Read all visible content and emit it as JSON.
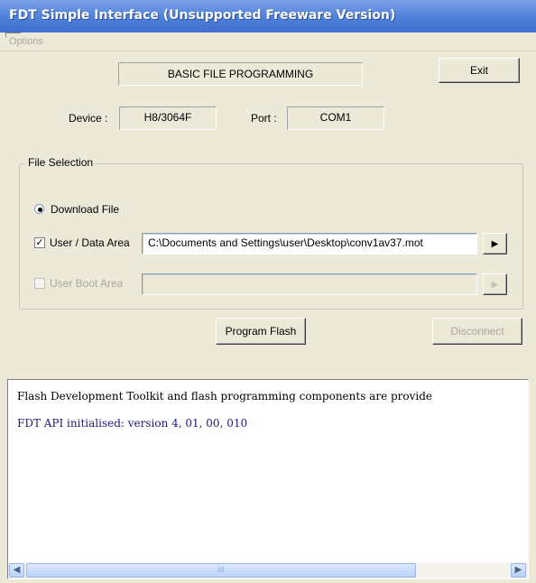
{
  "window": {
    "title": "FDT Simple Interface   (Unsupported Freeware Version)"
  },
  "menu": {
    "options_label": "Options"
  },
  "header": {
    "mode_label": "BASIC FILE PROGRAMMING",
    "exit_label": "Exit"
  },
  "device": {
    "label": "Device :",
    "value": "H8/3064F"
  },
  "port": {
    "label": "Port :",
    "value": "COM1"
  },
  "file_selection": {
    "title": "File Selection",
    "download_label": "Download File",
    "download_selected": true,
    "user_data_label": "User / Data Area",
    "user_data_checked": true,
    "user_data_path": "C:\\Documents and Settings\\user\\Desktop\\conv1av37.mot",
    "browse_icon": "play-arrow-icon",
    "user_boot_label": "User Boot Area",
    "user_boot_checked": false,
    "user_boot_path": ""
  },
  "actions": {
    "program_flash_label": "Program Flash",
    "disconnect_label": "Disconnect"
  },
  "log": {
    "lines": [
      "Flash Development Toolkit and flash programming components are provide",
      "FDT API initialised: version 4, 01, 00, 010"
    ],
    "line_colors": [
      "#000000",
      "#1a1a80"
    ],
    "scroll_thumb_grip": "III"
  },
  "colors": {
    "titlebar": "#4e7fd9",
    "window_bg": "#ece9d8",
    "log_info_text": "#1a1a80"
  }
}
